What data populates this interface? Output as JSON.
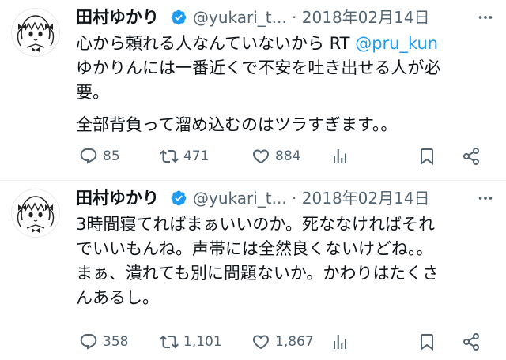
{
  "colors": {
    "text": "#0f1419",
    "secondary": "#536471",
    "link": "#1d9bf0",
    "verified": "#1d9bf0",
    "divider": "#eff3f4"
  },
  "tweets": [
    {
      "author_name": "田村ゆかり",
      "handle_date": "@yukari_t... · 2018年02月14日",
      "lines": [
        {
          "text": "心から頼れる人なんていないから RT ",
          "mention": "@pru_kun"
        },
        {
          "text": "ゆかりんには一番近くで不安を吐き出せる人が必"
        },
        {
          "text": "要。"
        },
        {
          "text": ""
        },
        {
          "text": "全部背負って溜め込むのはツラすぎます。。"
        }
      ],
      "replies": "85",
      "retweets": "471",
      "likes": "884"
    },
    {
      "author_name": "田村ゆかり",
      "handle_date": "@yukari_t... · 2018年02月14日",
      "lines": [
        {
          "text": "3時間寝てればまぁいいのか。死ななければそれ"
        },
        {
          "text": "でいいもんね。声帯には全然良くないけどね。。"
        },
        {
          "text": "まぁ、潰れても別に問題ないか。かわりはたくさ"
        },
        {
          "text": "んあるし。"
        }
      ],
      "replies": "358",
      "retweets": "1,101",
      "likes": "1,867"
    }
  ],
  "icons": {
    "verified": "verified-badge-icon",
    "more": "more-options-icon",
    "reply": "reply-icon",
    "retweet": "retweet-icon",
    "like": "heart-icon",
    "views": "views-chart-icon",
    "bookmark": "bookmark-icon",
    "share": "share-icon"
  }
}
